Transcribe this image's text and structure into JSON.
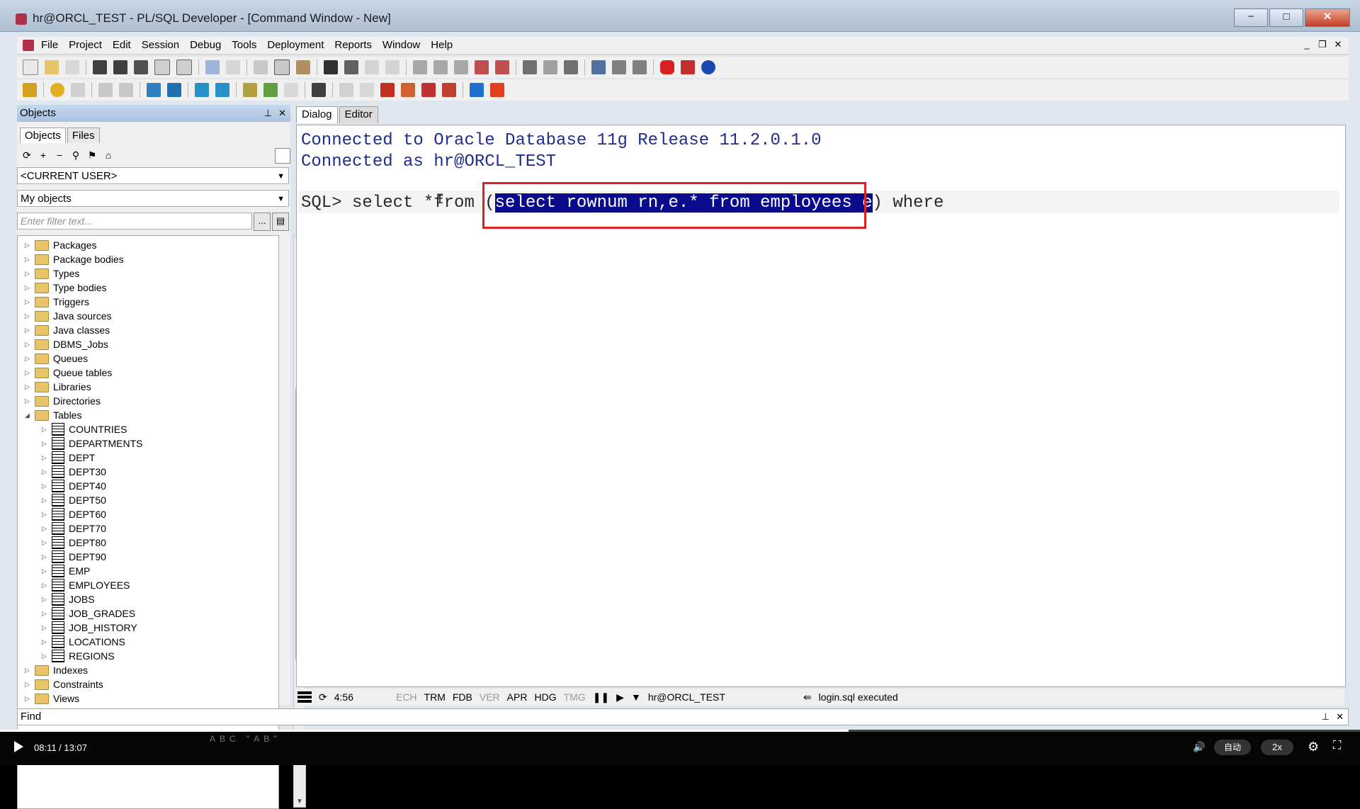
{
  "window": {
    "title": "hr@ORCL_TEST - PL/SQL Developer - [Command Window - New]",
    "btn_min": "−",
    "btn_max": "□",
    "btn_close": "✕"
  },
  "menu": {
    "items": [
      "File",
      "Project",
      "Edit",
      "Session",
      "Debug",
      "Tools",
      "Deployment",
      "Reports",
      "Window",
      "Help"
    ],
    "mdi_min": "_",
    "mdi_restore": "❐",
    "mdi_close": "✕"
  },
  "objects_panel": {
    "header": "Objects",
    "pin": "⊥",
    "close": "✕",
    "tabs": [
      "Objects",
      "Files"
    ],
    "user_select": "<CURRENT USER>",
    "scope_select": "My objects",
    "filter_placeholder": "Enter filter text...",
    "filter_btn": "...",
    "tree": [
      {
        "label": "Packages",
        "level": 0,
        "kind": "folder",
        "expanded": false
      },
      {
        "label": "Package bodies",
        "level": 0,
        "kind": "folder",
        "expanded": false
      },
      {
        "label": "Types",
        "level": 0,
        "kind": "folder",
        "expanded": false
      },
      {
        "label": "Type bodies",
        "level": 0,
        "kind": "folder",
        "expanded": false
      },
      {
        "label": "Triggers",
        "level": 0,
        "kind": "folder",
        "expanded": false
      },
      {
        "label": "Java sources",
        "level": 0,
        "kind": "folder",
        "expanded": false
      },
      {
        "label": "Java classes",
        "level": 0,
        "kind": "folder",
        "expanded": false
      },
      {
        "label": "DBMS_Jobs",
        "level": 0,
        "kind": "folder",
        "expanded": false
      },
      {
        "label": "Queues",
        "level": 0,
        "kind": "folder",
        "expanded": false
      },
      {
        "label": "Queue tables",
        "level": 0,
        "kind": "folder",
        "expanded": false
      },
      {
        "label": "Libraries",
        "level": 0,
        "kind": "folder",
        "expanded": false
      },
      {
        "label": "Directories",
        "level": 0,
        "kind": "folder",
        "expanded": false
      },
      {
        "label": "Tables",
        "level": 0,
        "kind": "folder",
        "expanded": true
      },
      {
        "label": "COUNTRIES",
        "level": 1,
        "kind": "table",
        "expanded": false
      },
      {
        "label": "DEPARTMENTS",
        "level": 1,
        "kind": "table",
        "expanded": false
      },
      {
        "label": "DEPT",
        "level": 1,
        "kind": "table",
        "expanded": false
      },
      {
        "label": "DEPT30",
        "level": 1,
        "kind": "table",
        "expanded": false
      },
      {
        "label": "DEPT40",
        "level": 1,
        "kind": "table",
        "expanded": false
      },
      {
        "label": "DEPT50",
        "level": 1,
        "kind": "table",
        "expanded": false
      },
      {
        "label": "DEPT60",
        "level": 1,
        "kind": "table",
        "expanded": false
      },
      {
        "label": "DEPT70",
        "level": 1,
        "kind": "table",
        "expanded": false
      },
      {
        "label": "DEPT80",
        "level": 1,
        "kind": "table",
        "expanded": false
      },
      {
        "label": "DEPT90",
        "level": 1,
        "kind": "table",
        "expanded": false
      },
      {
        "label": "EMP",
        "level": 1,
        "kind": "table",
        "expanded": false
      },
      {
        "label": "EMPLOYEES",
        "level": 1,
        "kind": "table",
        "expanded": false
      },
      {
        "label": "JOBS",
        "level": 1,
        "kind": "table",
        "expanded": false
      },
      {
        "label": "JOB_GRADES",
        "level": 1,
        "kind": "table",
        "expanded": false
      },
      {
        "label": "JOB_HISTORY",
        "level": 1,
        "kind": "table",
        "expanded": false
      },
      {
        "label": "LOCATIONS",
        "level": 1,
        "kind": "table",
        "expanded": false
      },
      {
        "label": "REGIONS",
        "level": 1,
        "kind": "table",
        "expanded": false
      },
      {
        "label": "Indexes",
        "level": 0,
        "kind": "folder",
        "expanded": false
      },
      {
        "label": "Constraints",
        "level": 0,
        "kind": "folder",
        "expanded": false
      },
      {
        "label": "Views",
        "level": 0,
        "kind": "folder",
        "expanded": false
      }
    ]
  },
  "command_window": {
    "tabs": [
      "Dialog",
      "Editor"
    ],
    "line1": "Connected to Oracle Database 11g Release 11.2.0.1.0",
    "line2": "Connected as hr@ORCL_TEST",
    "prompt": "SQL> select *from (",
    "selected": "select rownum rn,e.* from employees e",
    "tail": ") where"
  },
  "status_bar": {
    "position": "4:56",
    "flags": [
      "ECH",
      "TRM",
      "FDB",
      "VER",
      "APR",
      "HDG",
      "TMG"
    ],
    "flags_active": [
      false,
      true,
      true,
      false,
      true,
      true,
      false
    ],
    "connection": "hr@ORCL_TEST",
    "message": "login.sql executed"
  },
  "find_bar": {
    "label": "Find",
    "pin": "⊥",
    "close": "✕"
  },
  "video": {
    "time": "08:11 / 13:07",
    "played_fraction": 0.624,
    "auto_label": "自动",
    "speed_label": "2x",
    "faint_overlay": "ABC \"AB\""
  },
  "colors": {
    "selection": "#0a0a8c",
    "console_text": "#1f2e8c",
    "highlight_box": "#e02020"
  }
}
